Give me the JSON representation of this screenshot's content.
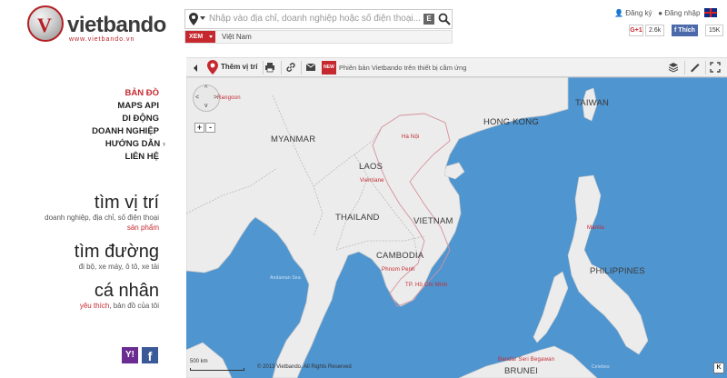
{
  "logo": {
    "name": "vietbando",
    "url": "www.vietbando.vn"
  },
  "search": {
    "placeholder": "Nhập vào địa chỉ, doanh nghiệp hoặc số điện thoại...",
    "region_btn": "XEM",
    "region_value": "Việt Nam"
  },
  "auth": {
    "register": "Đăng ký",
    "login": "Đăng nhập"
  },
  "social": {
    "gplus": "G+1",
    "gplus_count": "2.6k",
    "fb_like": "Thích",
    "fb_count": "15K"
  },
  "toolbar": {
    "add_location": "Thêm vị trí",
    "new_badge": "NEW",
    "message": "Phiên bản Vietbando trên thiết bị cầm ứng"
  },
  "menu": [
    {
      "label": "BẢN ĐỒ",
      "active": true
    },
    {
      "label": "MAPS API"
    },
    {
      "label": "DI ĐỘNG"
    },
    {
      "label": "DOANH NGHIỆP"
    },
    {
      "label": "HƯỚNG DẪN",
      "submenu": true
    },
    {
      "label": "LIÊN HỆ"
    }
  ],
  "features": {
    "find_location": {
      "title": "tìm vị trí",
      "desc": "doanh nghiệp, địa chỉ, số điện thoại",
      "link": "sản phẩm"
    },
    "find_route": {
      "title": "tìm đường",
      "desc": "đi bộ, xe máy, ô tô, xe tải"
    },
    "personal": {
      "title": "cá nhân",
      "link": "yêu thích",
      "desc": "bản đồ của tôi"
    }
  },
  "map": {
    "labels": {
      "myanmar": "MYANMAR",
      "laos": "LAOS",
      "thailand": "THAILAND",
      "vietnam": "VIETNAM",
      "cambodia": "CAMBODIA",
      "hongkong": "HONG KONG",
      "taiwan": "TAIWAN",
      "philippines": "PHILIPPINES",
      "brunei": "BRUNEI"
    },
    "cities": {
      "hanoi": "Hà Nội",
      "vientiane": "Vientiane",
      "phnompenh": "Phnom Penh",
      "hcm": "TP. Hồ Chí Minh",
      "manila": "Manila",
      "bsb": "Bandar Seri Begawan"
    },
    "seas": {
      "andaman": "Andaman Sea",
      "celebes": "Celebes"
    },
    "city_small": {
      "nguyen": "Rangoon"
    },
    "scale": "500 km",
    "copyright": "© 2013 Vietbando. All Rights Reserved"
  },
  "colors": {
    "brand_red": "#c5282e",
    "sea": "#4f95d0",
    "land": "#ececec"
  }
}
